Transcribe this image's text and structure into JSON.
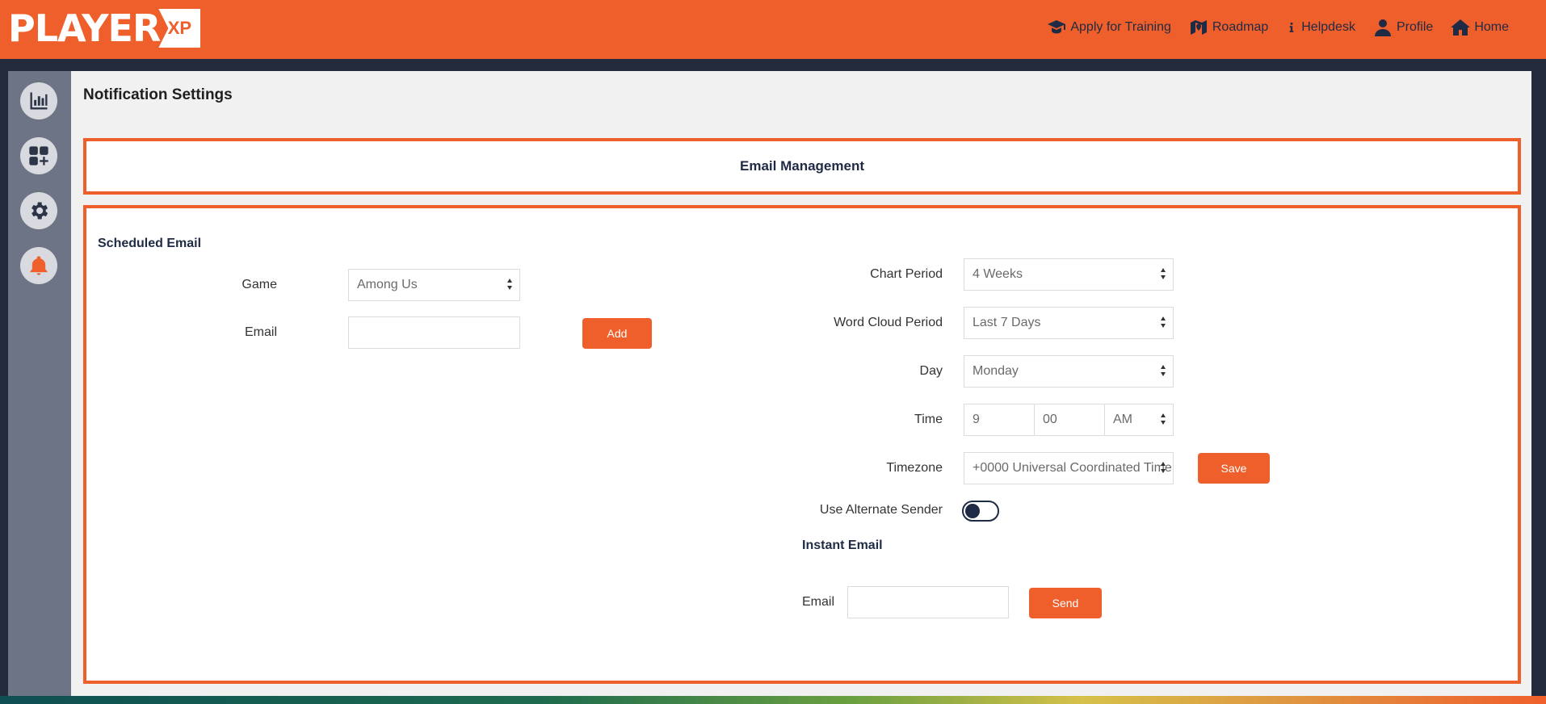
{
  "app": {
    "logo_main": "PLAYER",
    "logo_badge": "XP"
  },
  "nav": [
    {
      "label": "Apply for Training",
      "icon": "graduation-cap-icon"
    },
    {
      "label": "Roadmap",
      "icon": "map-icon"
    },
    {
      "label": "Helpdesk",
      "icon": "info-icon"
    },
    {
      "label": "Profile",
      "icon": "user-icon"
    },
    {
      "label": "Home",
      "icon": "home-icon"
    }
  ],
  "sidebar": {
    "items": [
      {
        "icon": "chart-bar-icon"
      },
      {
        "icon": "add-widget-icon"
      },
      {
        "icon": "gear-icon"
      },
      {
        "icon": "bell-icon",
        "active": true
      }
    ]
  },
  "page": {
    "title": "Notification Settings"
  },
  "panel": {
    "title": "Email Management"
  },
  "scheduled": {
    "title": "Scheduled Email",
    "game_label": "Game",
    "game_value": "Among Us",
    "email_label": "Email",
    "email_value": "",
    "add_label": "Add",
    "chart_period_label": "Chart Period",
    "chart_period_value": "4 Weeks",
    "word_cloud_label": "Word Cloud Period",
    "word_cloud_value": "Last 7 Days",
    "day_label": "Day",
    "day_value": "Monday",
    "time_label": "Time",
    "time_hour": "9",
    "time_minute": "00",
    "time_ampm": "AM",
    "timezone_label": "Timezone",
    "timezone_value": "+0000 Universal Coordinated Time",
    "save_label": "Save",
    "alt_sender_label": "Use Alternate Sender",
    "alt_sender_on": false
  },
  "instant": {
    "title": "Instant Email",
    "email_label": "Email",
    "email_value": "",
    "send_label": "Send"
  },
  "colors": {
    "accent": "#ef5f2b",
    "navy": "#1f2a44",
    "sidebar": "#6c7486"
  }
}
